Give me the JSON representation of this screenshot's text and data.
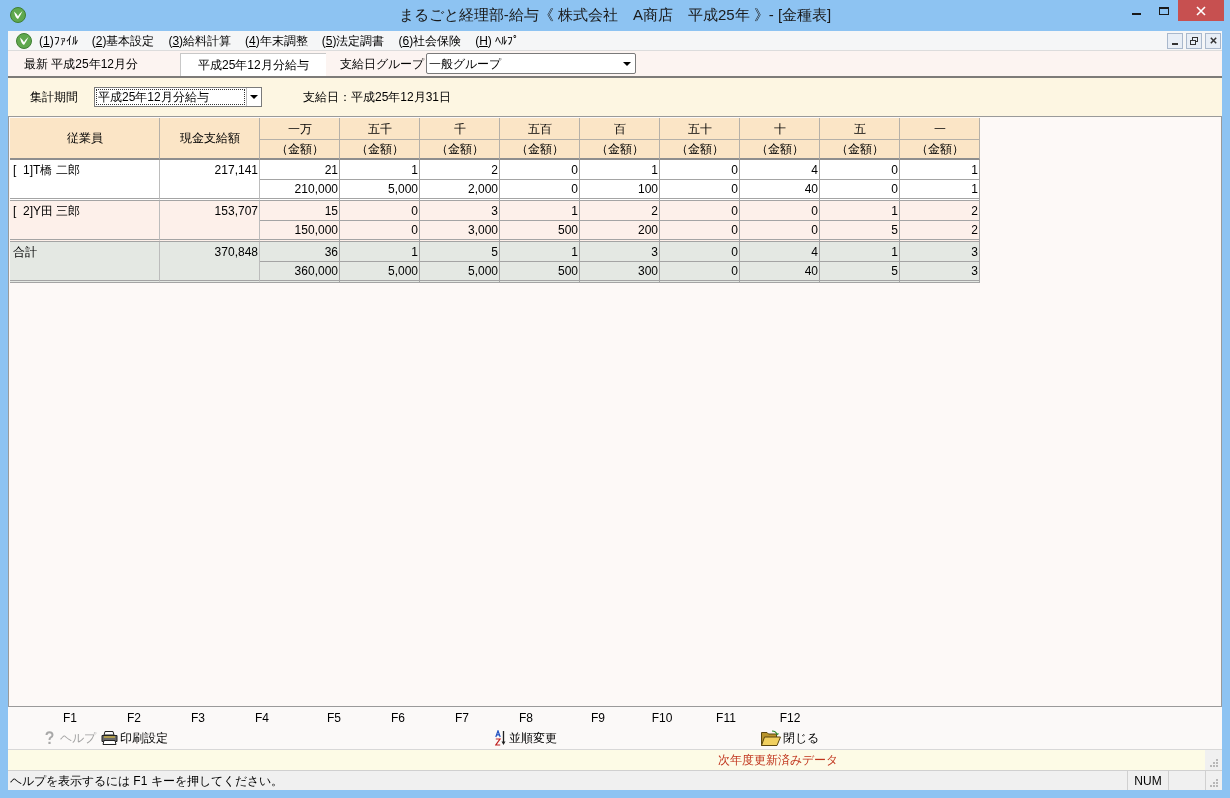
{
  "window": {
    "title": "まるごと経理部-給与《 株式会社　A商店　平成25年 》- [金種表]"
  },
  "menu": {
    "items": [
      "(1)ﾌｧｲﾙ",
      "(2)基本設定",
      "(3)給料計算",
      "(4)年末調整",
      "(5)法定調書",
      "(6)社会保険",
      "(H) ﾍﾙﾌﾟ"
    ]
  },
  "toolbar": {
    "latest": "最新 平成25年12月分",
    "current_period": "平成25年12月分給与",
    "group_label": "支給日グループ",
    "group_select": {
      "value": "一般グループ"
    }
  },
  "filter": {
    "period_label": "集計期間",
    "period_select": {
      "value": "平成25年12月分給与"
    },
    "pay_date": "支給日：平成25年12月31日"
  },
  "table": {
    "columns": [
      {
        "label": "従業員"
      },
      {
        "label": "現金支給額"
      },
      {
        "label": "一万",
        "unit": "（金額）"
      },
      {
        "label": "五千",
        "unit": "（金額）"
      },
      {
        "label": "千",
        "unit": "（金額）"
      },
      {
        "label": "五百",
        "unit": "（金額）"
      },
      {
        "label": "百",
        "unit": "（金額）"
      },
      {
        "label": "五十",
        "unit": "（金額）"
      },
      {
        "label": "十",
        "unit": "（金額）"
      },
      {
        "label": "五",
        "unit": "（金額）"
      },
      {
        "label": "一",
        "unit": "（金額）"
      }
    ],
    "rows": [
      {
        "kind": "employee",
        "name": "[  1]T橋 二郎",
        "pay": "217,141",
        "counts": [
          "21",
          "1",
          "2",
          "0",
          "1",
          "0",
          "4",
          "0",
          "1"
        ],
        "amounts": [
          "210,000",
          "5,000",
          "2,000",
          "0",
          "100",
          "0",
          "40",
          "0",
          "1"
        ]
      },
      {
        "kind": "employee",
        "name": "[  2]Y田 三郎",
        "pay": "153,707",
        "counts": [
          "15",
          "0",
          "3",
          "1",
          "2",
          "0",
          "0",
          "1",
          "2"
        ],
        "amounts": [
          "150,000",
          "0",
          "3,000",
          "500",
          "200",
          "0",
          "0",
          "5",
          "2"
        ]
      },
      {
        "kind": "total",
        "name": "合計",
        "pay": "370,848",
        "counts": [
          "36",
          "1",
          "5",
          "1",
          "3",
          "0",
          "4",
          "1",
          "3"
        ],
        "amounts": [
          "360,000",
          "5,000",
          "5,000",
          "500",
          "300",
          "0",
          "40",
          "5",
          "3"
        ]
      }
    ]
  },
  "function_keys": [
    {
      "key": "F1",
      "button": {
        "kind": "help",
        "label": "ヘルプ",
        "disabled": true
      }
    },
    {
      "key": "F2",
      "button": {
        "kind": "print",
        "label": "印刷設定",
        "disabled": false
      }
    },
    {
      "key": "F3"
    },
    {
      "key": "F4"
    },
    {
      "key": "F5"
    },
    {
      "key": "F6"
    },
    {
      "key": "F7"
    },
    {
      "key": "F8",
      "button": {
        "kind": "sort",
        "label": "並順変更",
        "disabled": false
      }
    },
    {
      "key": "F9"
    },
    {
      "key": "F10"
    },
    {
      "key": "F11"
    },
    {
      "key": "F12",
      "button": {
        "kind": "close",
        "label": "閉じる",
        "disabled": false
      }
    }
  ],
  "notice": "次年度更新済みデータ",
  "status_bar": {
    "message": "ヘルプを表示するには F1 キーを押してください。",
    "indicator": "NUM"
  }
}
